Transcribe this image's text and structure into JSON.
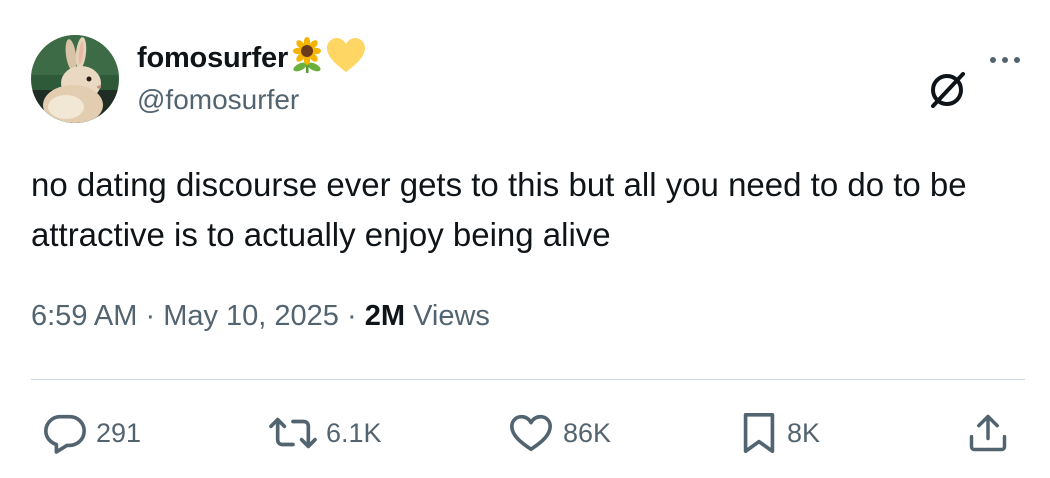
{
  "author": {
    "display_name": "fomosurfer",
    "emojis": [
      "sunflower-emoji",
      "yellow-heart-emoji"
    ],
    "handle": "@fomosurfer",
    "avatar": "bunny-avatar"
  },
  "tweet": {
    "text": "no dating discourse ever gets to this but all you need to do to be attractive is to actually enjoy being alive",
    "time": "6:59 AM",
    "separator": "·",
    "date": "May 10, 2025",
    "views_count": "2M",
    "views_label": "Views"
  },
  "actions": {
    "replies": "291",
    "reposts": "6.1K",
    "likes": "86K",
    "bookmarks": "8K"
  },
  "icons": {
    "grok": "grok-icon",
    "more": "more-icon",
    "reply": "reply-icon",
    "repost": "repost-icon",
    "like": "heart-icon",
    "bookmark": "bookmark-icon",
    "share": "share-icon"
  },
  "colors": {
    "text": "#0f1419",
    "secondary": "#536471",
    "divider": "#cfd9de",
    "sunflower_petal": "#f4b400",
    "heart_yellow": "#fdd663"
  }
}
